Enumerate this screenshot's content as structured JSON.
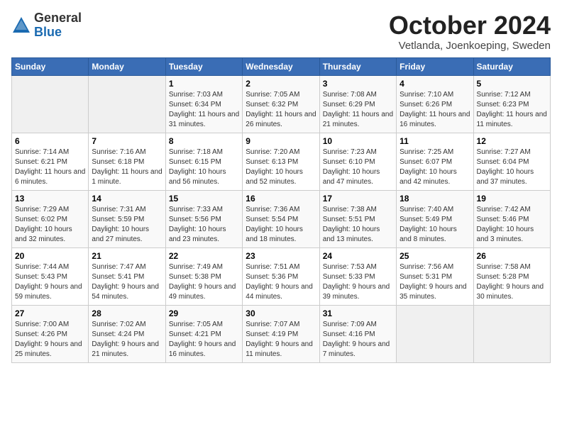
{
  "header": {
    "logo_general": "General",
    "logo_blue": "Blue",
    "month_title": "October 2024",
    "subtitle": "Vetlanda, Joenkoeping, Sweden"
  },
  "weekdays": [
    "Sunday",
    "Monday",
    "Tuesday",
    "Wednesday",
    "Thursday",
    "Friday",
    "Saturday"
  ],
  "weeks": [
    [
      {
        "day": "",
        "info": ""
      },
      {
        "day": "",
        "info": ""
      },
      {
        "day": "1",
        "info": "Sunrise: 7:03 AM\nSunset: 6:34 PM\nDaylight: 11 hours and 31 minutes."
      },
      {
        "day": "2",
        "info": "Sunrise: 7:05 AM\nSunset: 6:32 PM\nDaylight: 11 hours and 26 minutes."
      },
      {
        "day": "3",
        "info": "Sunrise: 7:08 AM\nSunset: 6:29 PM\nDaylight: 11 hours and 21 minutes."
      },
      {
        "day": "4",
        "info": "Sunrise: 7:10 AM\nSunset: 6:26 PM\nDaylight: 11 hours and 16 minutes."
      },
      {
        "day": "5",
        "info": "Sunrise: 7:12 AM\nSunset: 6:23 PM\nDaylight: 11 hours and 11 minutes."
      }
    ],
    [
      {
        "day": "6",
        "info": "Sunrise: 7:14 AM\nSunset: 6:21 PM\nDaylight: 11 hours and 6 minutes."
      },
      {
        "day": "7",
        "info": "Sunrise: 7:16 AM\nSunset: 6:18 PM\nDaylight: 11 hours and 1 minute."
      },
      {
        "day": "8",
        "info": "Sunrise: 7:18 AM\nSunset: 6:15 PM\nDaylight: 10 hours and 56 minutes."
      },
      {
        "day": "9",
        "info": "Sunrise: 7:20 AM\nSunset: 6:13 PM\nDaylight: 10 hours and 52 minutes."
      },
      {
        "day": "10",
        "info": "Sunrise: 7:23 AM\nSunset: 6:10 PM\nDaylight: 10 hours and 47 minutes."
      },
      {
        "day": "11",
        "info": "Sunrise: 7:25 AM\nSunset: 6:07 PM\nDaylight: 10 hours and 42 minutes."
      },
      {
        "day": "12",
        "info": "Sunrise: 7:27 AM\nSunset: 6:04 PM\nDaylight: 10 hours and 37 minutes."
      }
    ],
    [
      {
        "day": "13",
        "info": "Sunrise: 7:29 AM\nSunset: 6:02 PM\nDaylight: 10 hours and 32 minutes."
      },
      {
        "day": "14",
        "info": "Sunrise: 7:31 AM\nSunset: 5:59 PM\nDaylight: 10 hours and 27 minutes."
      },
      {
        "day": "15",
        "info": "Sunrise: 7:33 AM\nSunset: 5:56 PM\nDaylight: 10 hours and 23 minutes."
      },
      {
        "day": "16",
        "info": "Sunrise: 7:36 AM\nSunset: 5:54 PM\nDaylight: 10 hours and 18 minutes."
      },
      {
        "day": "17",
        "info": "Sunrise: 7:38 AM\nSunset: 5:51 PM\nDaylight: 10 hours and 13 minutes."
      },
      {
        "day": "18",
        "info": "Sunrise: 7:40 AM\nSunset: 5:49 PM\nDaylight: 10 hours and 8 minutes."
      },
      {
        "day": "19",
        "info": "Sunrise: 7:42 AM\nSunset: 5:46 PM\nDaylight: 10 hours and 3 minutes."
      }
    ],
    [
      {
        "day": "20",
        "info": "Sunrise: 7:44 AM\nSunset: 5:43 PM\nDaylight: 9 hours and 59 minutes."
      },
      {
        "day": "21",
        "info": "Sunrise: 7:47 AM\nSunset: 5:41 PM\nDaylight: 9 hours and 54 minutes."
      },
      {
        "day": "22",
        "info": "Sunrise: 7:49 AM\nSunset: 5:38 PM\nDaylight: 9 hours and 49 minutes."
      },
      {
        "day": "23",
        "info": "Sunrise: 7:51 AM\nSunset: 5:36 PM\nDaylight: 9 hours and 44 minutes."
      },
      {
        "day": "24",
        "info": "Sunrise: 7:53 AM\nSunset: 5:33 PM\nDaylight: 9 hours and 39 minutes."
      },
      {
        "day": "25",
        "info": "Sunrise: 7:56 AM\nSunset: 5:31 PM\nDaylight: 9 hours and 35 minutes."
      },
      {
        "day": "26",
        "info": "Sunrise: 7:58 AM\nSunset: 5:28 PM\nDaylight: 9 hours and 30 minutes."
      }
    ],
    [
      {
        "day": "27",
        "info": "Sunrise: 7:00 AM\nSunset: 4:26 PM\nDaylight: 9 hours and 25 minutes."
      },
      {
        "day": "28",
        "info": "Sunrise: 7:02 AM\nSunset: 4:24 PM\nDaylight: 9 hours and 21 minutes."
      },
      {
        "day": "29",
        "info": "Sunrise: 7:05 AM\nSunset: 4:21 PM\nDaylight: 9 hours and 16 minutes."
      },
      {
        "day": "30",
        "info": "Sunrise: 7:07 AM\nSunset: 4:19 PM\nDaylight: 9 hours and 11 minutes."
      },
      {
        "day": "31",
        "info": "Sunrise: 7:09 AM\nSunset: 4:16 PM\nDaylight: 9 hours and 7 minutes."
      },
      {
        "day": "",
        "info": ""
      },
      {
        "day": "",
        "info": ""
      }
    ]
  ]
}
